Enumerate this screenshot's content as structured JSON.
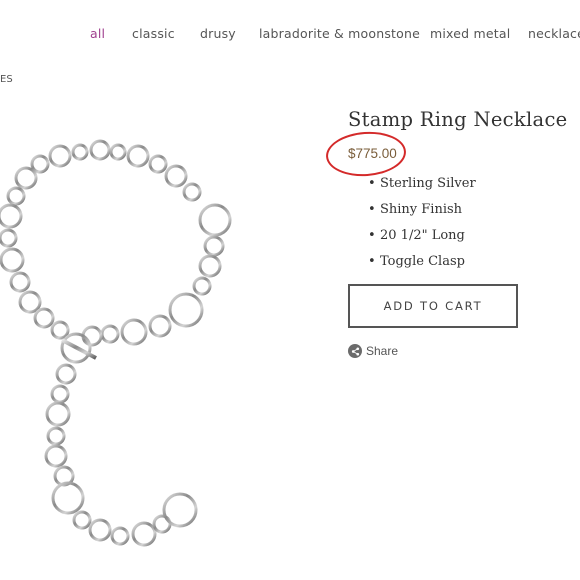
{
  "nav": {
    "items": [
      {
        "label": "all",
        "active": true
      },
      {
        "label": "classic",
        "active": false
      },
      {
        "label": "drusy",
        "active": false
      },
      {
        "label": "labradorite & moonstone",
        "active": false
      },
      {
        "label": "mixed metal",
        "active": false
      },
      {
        "label": "necklace",
        "active": false
      }
    ]
  },
  "breadcrumb_fragment": "ES",
  "product": {
    "title": "Stamp Ring Necklace",
    "price": "$775.00",
    "features": [
      "Sterling Silver",
      "Shiny Finish",
      "20 1/2\" Long",
      "Toggle Clasp"
    ],
    "add_to_cart_label": "ADD TO CART",
    "share_label": "Share"
  },
  "colors": {
    "active_nav": "#a0418f",
    "price_annotation_circle": "#d42a2a",
    "price_text": "#7a5d3a"
  },
  "icons": {
    "share": "share-icon"
  }
}
